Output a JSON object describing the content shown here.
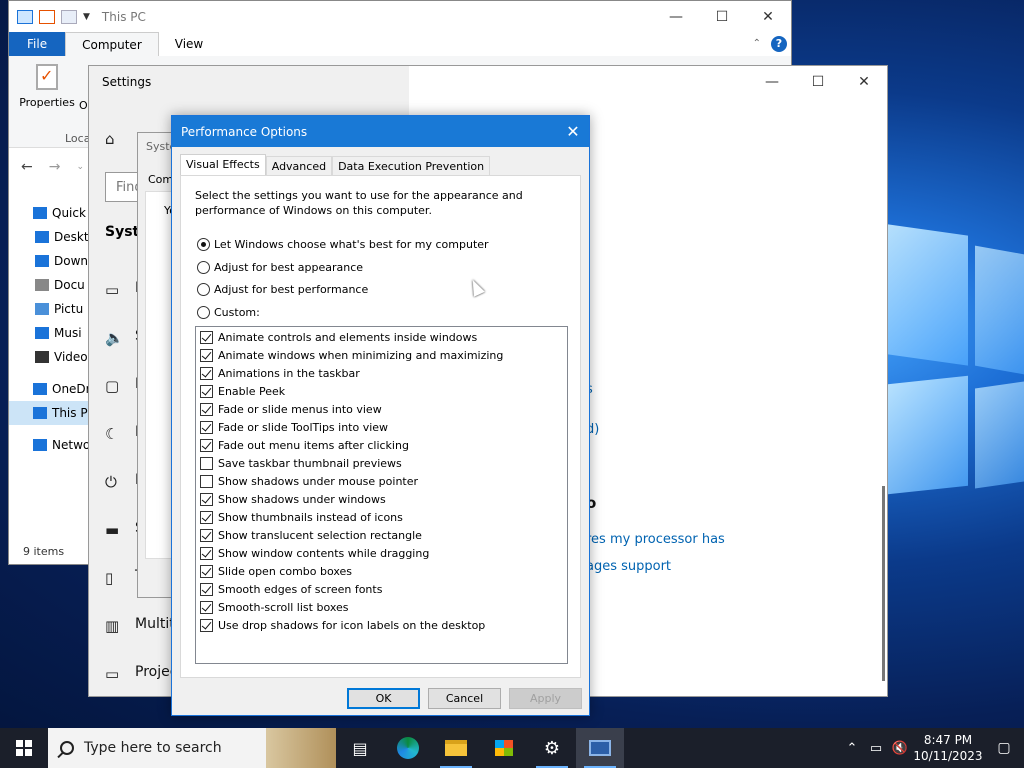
{
  "explorer": {
    "title": "This PC",
    "tabs": {
      "file": "File",
      "computer": "Computer",
      "view": "View"
    },
    "ribbon": {
      "properties": "Properties",
      "open_partial": "Op",
      "location_partial": "Loca"
    },
    "sidebar": [
      {
        "label": "Quick a",
        "icon": "star-icon",
        "top": true
      },
      {
        "label": "Deskt",
        "icon": "desktop-folder-icon"
      },
      {
        "label": "Down",
        "icon": "download-arrow-icon"
      },
      {
        "label": "Docu",
        "icon": "document-icon"
      },
      {
        "label": "Pictu",
        "icon": "pictures-icon"
      },
      {
        "label": "Musi",
        "icon": "music-note-icon"
      },
      {
        "label": "Video",
        "icon": "film-icon"
      },
      {
        "label": "OneDri",
        "icon": "cloud-icon",
        "top": true
      },
      {
        "label": "This PC",
        "icon": "computer-icon",
        "top": true,
        "selected": true
      },
      {
        "label": "Netwo",
        "icon": "network-icon",
        "top": true
      }
    ],
    "status": "9 items"
  },
  "settings": {
    "title": "Settings",
    "find_partial": "Find",
    "heading_partial": "System",
    "nav": [
      {
        "label": "D",
        "icon": "monitor-icon"
      },
      {
        "label": "S",
        "icon": "sound-icon"
      },
      {
        "label": "N",
        "icon": "notification-icon"
      },
      {
        "label": "F",
        "icon": "moon-icon"
      },
      {
        "label": "P",
        "icon": "power-icon"
      },
      {
        "label": "S",
        "icon": "battery-icon"
      },
      {
        "label": "T",
        "icon": "tablet-icon"
      },
      {
        "label": "Multit",
        "icon": "multitasking-icon"
      },
      {
        "label": "Projec",
        "icon": "projector-icon"
      }
    ],
    "links": {
      "s_partial": "s",
      "d_partial": "d)",
      "o_partial": "o",
      "processor": "res my processor has",
      "pages": "ages support"
    }
  },
  "sysprop": {
    "title_partial": "Syste",
    "tab_partial": "Com",
    "text_partial": "Yo"
  },
  "dialog": {
    "title": "Performance Options",
    "tabs": [
      "Visual Effects",
      "Advanced",
      "Data Execution Prevention"
    ],
    "description": "Select the settings you want to use for the appearance and performance of Windows on this computer.",
    "radios": [
      {
        "label": "Let Windows choose what's best for my computer",
        "selected": true
      },
      {
        "label": "Adjust for best appearance",
        "selected": false
      },
      {
        "label": "Adjust for best performance",
        "selected": false
      },
      {
        "label": "Custom:",
        "selected": false
      }
    ],
    "effects": [
      {
        "label": "Animate controls and elements inside windows",
        "checked": true
      },
      {
        "label": "Animate windows when minimizing and maximizing",
        "checked": true
      },
      {
        "label": "Animations in the taskbar",
        "checked": true
      },
      {
        "label": "Enable Peek",
        "checked": true
      },
      {
        "label": "Fade or slide menus into view",
        "checked": true
      },
      {
        "label": "Fade or slide ToolTips into view",
        "checked": true
      },
      {
        "label": "Fade out menu items after clicking",
        "checked": true
      },
      {
        "label": "Save taskbar thumbnail previews",
        "checked": false
      },
      {
        "label": "Show shadows under mouse pointer",
        "checked": false
      },
      {
        "label": "Show shadows under windows",
        "checked": true
      },
      {
        "label": "Show thumbnails instead of icons",
        "checked": true
      },
      {
        "label": "Show translucent selection rectangle",
        "checked": true
      },
      {
        "label": "Show window contents while dragging",
        "checked": true
      },
      {
        "label": "Slide open combo boxes",
        "checked": true
      },
      {
        "label": "Smooth edges of screen fonts",
        "checked": true
      },
      {
        "label": "Smooth-scroll list boxes",
        "checked": true
      },
      {
        "label": "Use drop shadows for icon labels on the desktop",
        "checked": true
      }
    ],
    "buttons": {
      "ok": "OK",
      "cancel": "Cancel",
      "apply": "Apply"
    }
  },
  "taskbar": {
    "search_placeholder": "Type here to search",
    "apps": [
      "task-view-icon",
      "edge-browser-icon",
      "file-explorer-icon",
      "store-icon",
      "settings-gear-icon",
      "system-properties-icon"
    ],
    "time": "8:47 PM",
    "date": "10/11/2023"
  },
  "colors": {
    "accent": "#1979d6",
    "link": "#0063b1",
    "taskbar": "#1b1f2a"
  }
}
